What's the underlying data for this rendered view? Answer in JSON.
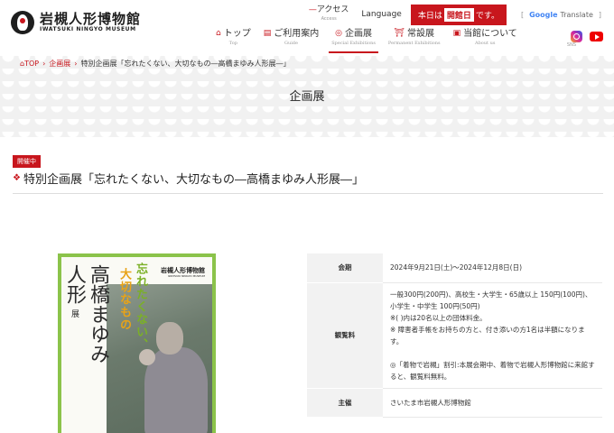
{
  "header": {
    "logo_jp": "岩槻人形博物館",
    "logo_en": "IWATSUKI NINGYO MUSEUM",
    "access_label": "アクセス",
    "access_en": "Access",
    "language_label": "Language",
    "today_prefix": "本日は",
    "today_status": "開館日",
    "today_suffix": "です。",
    "translate_brand": "Google",
    "translate_label": "Translate",
    "sns_label": "SNS"
  },
  "nav": [
    {
      "jp": "トップ",
      "en": "Top",
      "icon": "home-icon"
    },
    {
      "jp": "ご利用案内",
      "en": "Guide",
      "icon": "document-icon"
    },
    {
      "jp": "企画展",
      "en": "Special Exhibitions",
      "icon": "target-icon"
    },
    {
      "jp": "常設展",
      "en": "Permanent Exhibitions",
      "icon": "shrine-icon"
    },
    {
      "jp": "当館について",
      "en": "About us",
      "icon": "book-icon"
    }
  ],
  "breadcrumb": {
    "top": "TOP",
    "section": "企画展",
    "current": "特別企画展「忘れたくない、大切なもの―高橋まゆみ人形展―」"
  },
  "hero_title": "企画展",
  "exhibition": {
    "badge": "開催中",
    "title": "特別企画展「忘れたくない、大切なもの―高橋まゆみ人形展―」"
  },
  "poster": {
    "museum_jp": "岩槻人形博物館",
    "museum_en": "IWATSUKI NINGYO MUSEUM",
    "title_line1": "高橋まゆみ",
    "title_line2": "人形",
    "title_line3": "展",
    "catch_line1": "忘れたくない、",
    "catch_line2": "大切なもの"
  },
  "info": {
    "period_label": "会期",
    "period_value": "2024年9月21日(土)〜2024年12月8日(日)",
    "fee_label": "観覧料",
    "fee_line1": "一般300円(200円)、高校生・大学生・65歳以上 150円(100円)、小学生・中学生 100円(50円)",
    "fee_line2": "※( )内は20名以上の団体料金。",
    "fee_line3": "※ 障害者手帳をお持ちの方と、付き添いの方1名は半額になります。",
    "fee_line4": "◎「着物で岩槻」割引:本展会期中、着物で岩槻人形博物館に来館すると、観覧料無料。",
    "host_label": "主催",
    "host_value": "さいたま市岩槻人形博物館"
  },
  "colors": {
    "accent": "#c8161d",
    "poster_border": "#8bc34a"
  }
}
